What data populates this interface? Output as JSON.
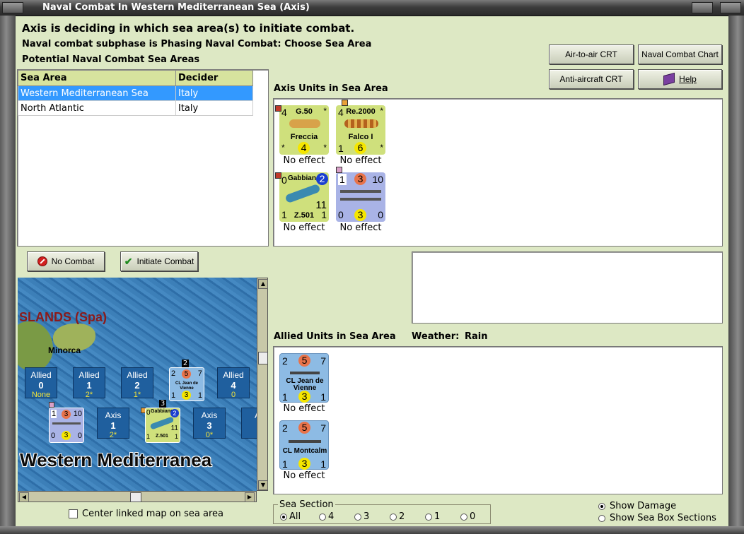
{
  "window": {
    "title": "Naval Combat In Western Mediterranean Sea (Axis)"
  },
  "header": {
    "line1": "Axis is deciding in which sea area(s) to initiate combat.",
    "line2": "Naval combat subphase is Phasing Naval Combat: Choose Sea Area",
    "line3": "Potential Naval Combat Sea Areas"
  },
  "toolbar": {
    "air_to_air": "Air-to-air CRT",
    "naval_chart": "Naval Combat Chart",
    "anti_aircraft": "Anti-aircraft CRT",
    "help": "Help"
  },
  "sea_table": {
    "columns": [
      "Sea Area",
      "Decider"
    ],
    "rows": [
      {
        "area": "Western Mediterranean Sea",
        "decider": "Italy",
        "selected": true
      },
      {
        "area": "North Atlantic",
        "decider": "Italy",
        "selected": false
      }
    ]
  },
  "axis_units": {
    "label": "Axis Units in Sea Area",
    "units": [
      {
        "tl": "4",
        "title": "G.50",
        "tr": "*",
        "name": "Freccia",
        "bl": "*",
        "val": "4",
        "br": "*",
        "effect": "No effect"
      },
      {
        "tl": "4",
        "title": "Re.2000",
        "tr": "*",
        "name": "Falco I",
        "bl": "1",
        "val": "6",
        "br": "*",
        "effect": "No effect"
      },
      {
        "tl": "0",
        "title": "Gabbiano",
        "tr": "2",
        "name": "Z.501",
        "bl": "1",
        "val": "11",
        "br": "1",
        "effect": "No effect"
      },
      {
        "tl": "1",
        "mid": "3",
        "tr": "10",
        "bl": "0",
        "val": "3",
        "br": "0",
        "effect": "No effect"
      }
    ]
  },
  "allied_units": {
    "label": "Allied Units in Sea Area",
    "weather_label": "Weather:",
    "weather_value": "Rain",
    "units": [
      {
        "tl": "2",
        "mid": "5",
        "tr": "7",
        "name": "CL Jean de Vienne",
        "bl": "1",
        "val": "3",
        "br": "1",
        "effect": "No effect"
      },
      {
        "tl": "2",
        "mid": "5",
        "tr": "7",
        "name": "CL Montcalm",
        "bl": "1",
        "val": "3",
        "br": "1",
        "effect": "No effect"
      }
    ]
  },
  "actions": {
    "no_combat": "No Combat",
    "initiate_combat": "Initiate Combat"
  },
  "map": {
    "islands_label": "SLANDS (Spa)",
    "minorca": "Minorca",
    "sea_label": "Western Mediterranea",
    "boxes_top": [
      {
        "side": "Allied",
        "num": "0",
        "extra": "None"
      },
      {
        "side": "Allied",
        "num": "1",
        "extra": "2*"
      },
      {
        "side": "Allied",
        "num": "2",
        "extra": "1*"
      },
      {
        "side": "Allied",
        "num": "4",
        "extra": "0"
      }
    ],
    "boxes_bottom": [
      {
        "side": "Axis",
        "num": "1",
        "extra": "2*"
      },
      {
        "side": "Axis",
        "num": "3",
        "extra": "0*"
      },
      {
        "side": "A",
        "num": "",
        "extra": ""
      }
    ],
    "stack_badges": [
      "2",
      "3"
    ],
    "mini_allied": {
      "tl": "2",
      "mid": "5",
      "tr": "7",
      "name": "CL Jean de Vienne",
      "bl": "1",
      "val": "3",
      "br": "1"
    },
    "mini_axis_ship": {
      "tl": "1",
      "mid": "3",
      "tr": "10",
      "bl": "0",
      "val": "3",
      "br": "0"
    },
    "mini_axis_air": {
      "tl": "0",
      "title": "Gabbiano",
      "tr": "2",
      "name": "Z.501",
      "bl": "1",
      "val": "11",
      "br": "1"
    }
  },
  "center_map_label": "Center linked map on sea area",
  "sea_section": {
    "label": "Sea Section",
    "options": [
      "All",
      "4",
      "3",
      "2",
      "1",
      "0"
    ],
    "selected": "All"
  },
  "display_options": {
    "show_damage": "Show Damage",
    "show_damage_on": true,
    "show_sections": "Show Sea Box Sections",
    "show_sections_on": false
  },
  "colors": {
    "background": "#dde8c4",
    "selected_row": "#3399ff",
    "air_counter": "#cfe07c",
    "axis_ship": "#a9b3e6",
    "allied_ship": "#8dbbe4"
  }
}
